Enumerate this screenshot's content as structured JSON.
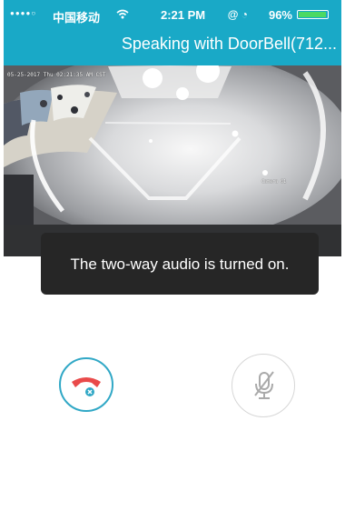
{
  "status_bar": {
    "signal": "●●●●○",
    "carrier": "中国移动",
    "time": "2:21 PM",
    "icons": "@ ◔",
    "battery_percent": "96%",
    "battery_level": 0.96
  },
  "header": {
    "title": "Speaking with DoorBell(712..."
  },
  "video": {
    "timestamp": "05-25-2017 Thu 02:21:35 AM CST",
    "camera_label": "Camera 01"
  },
  "toast": {
    "message": "The two-way audio is turned on."
  },
  "controls": {
    "hangup_icon": "phone-hangup-icon",
    "mic_icon": "microphone-muted-icon"
  },
  "colors": {
    "accent": "#19a9c7",
    "hangup_red": "#e94a4a",
    "mic_gray": "#aaaaaa"
  }
}
